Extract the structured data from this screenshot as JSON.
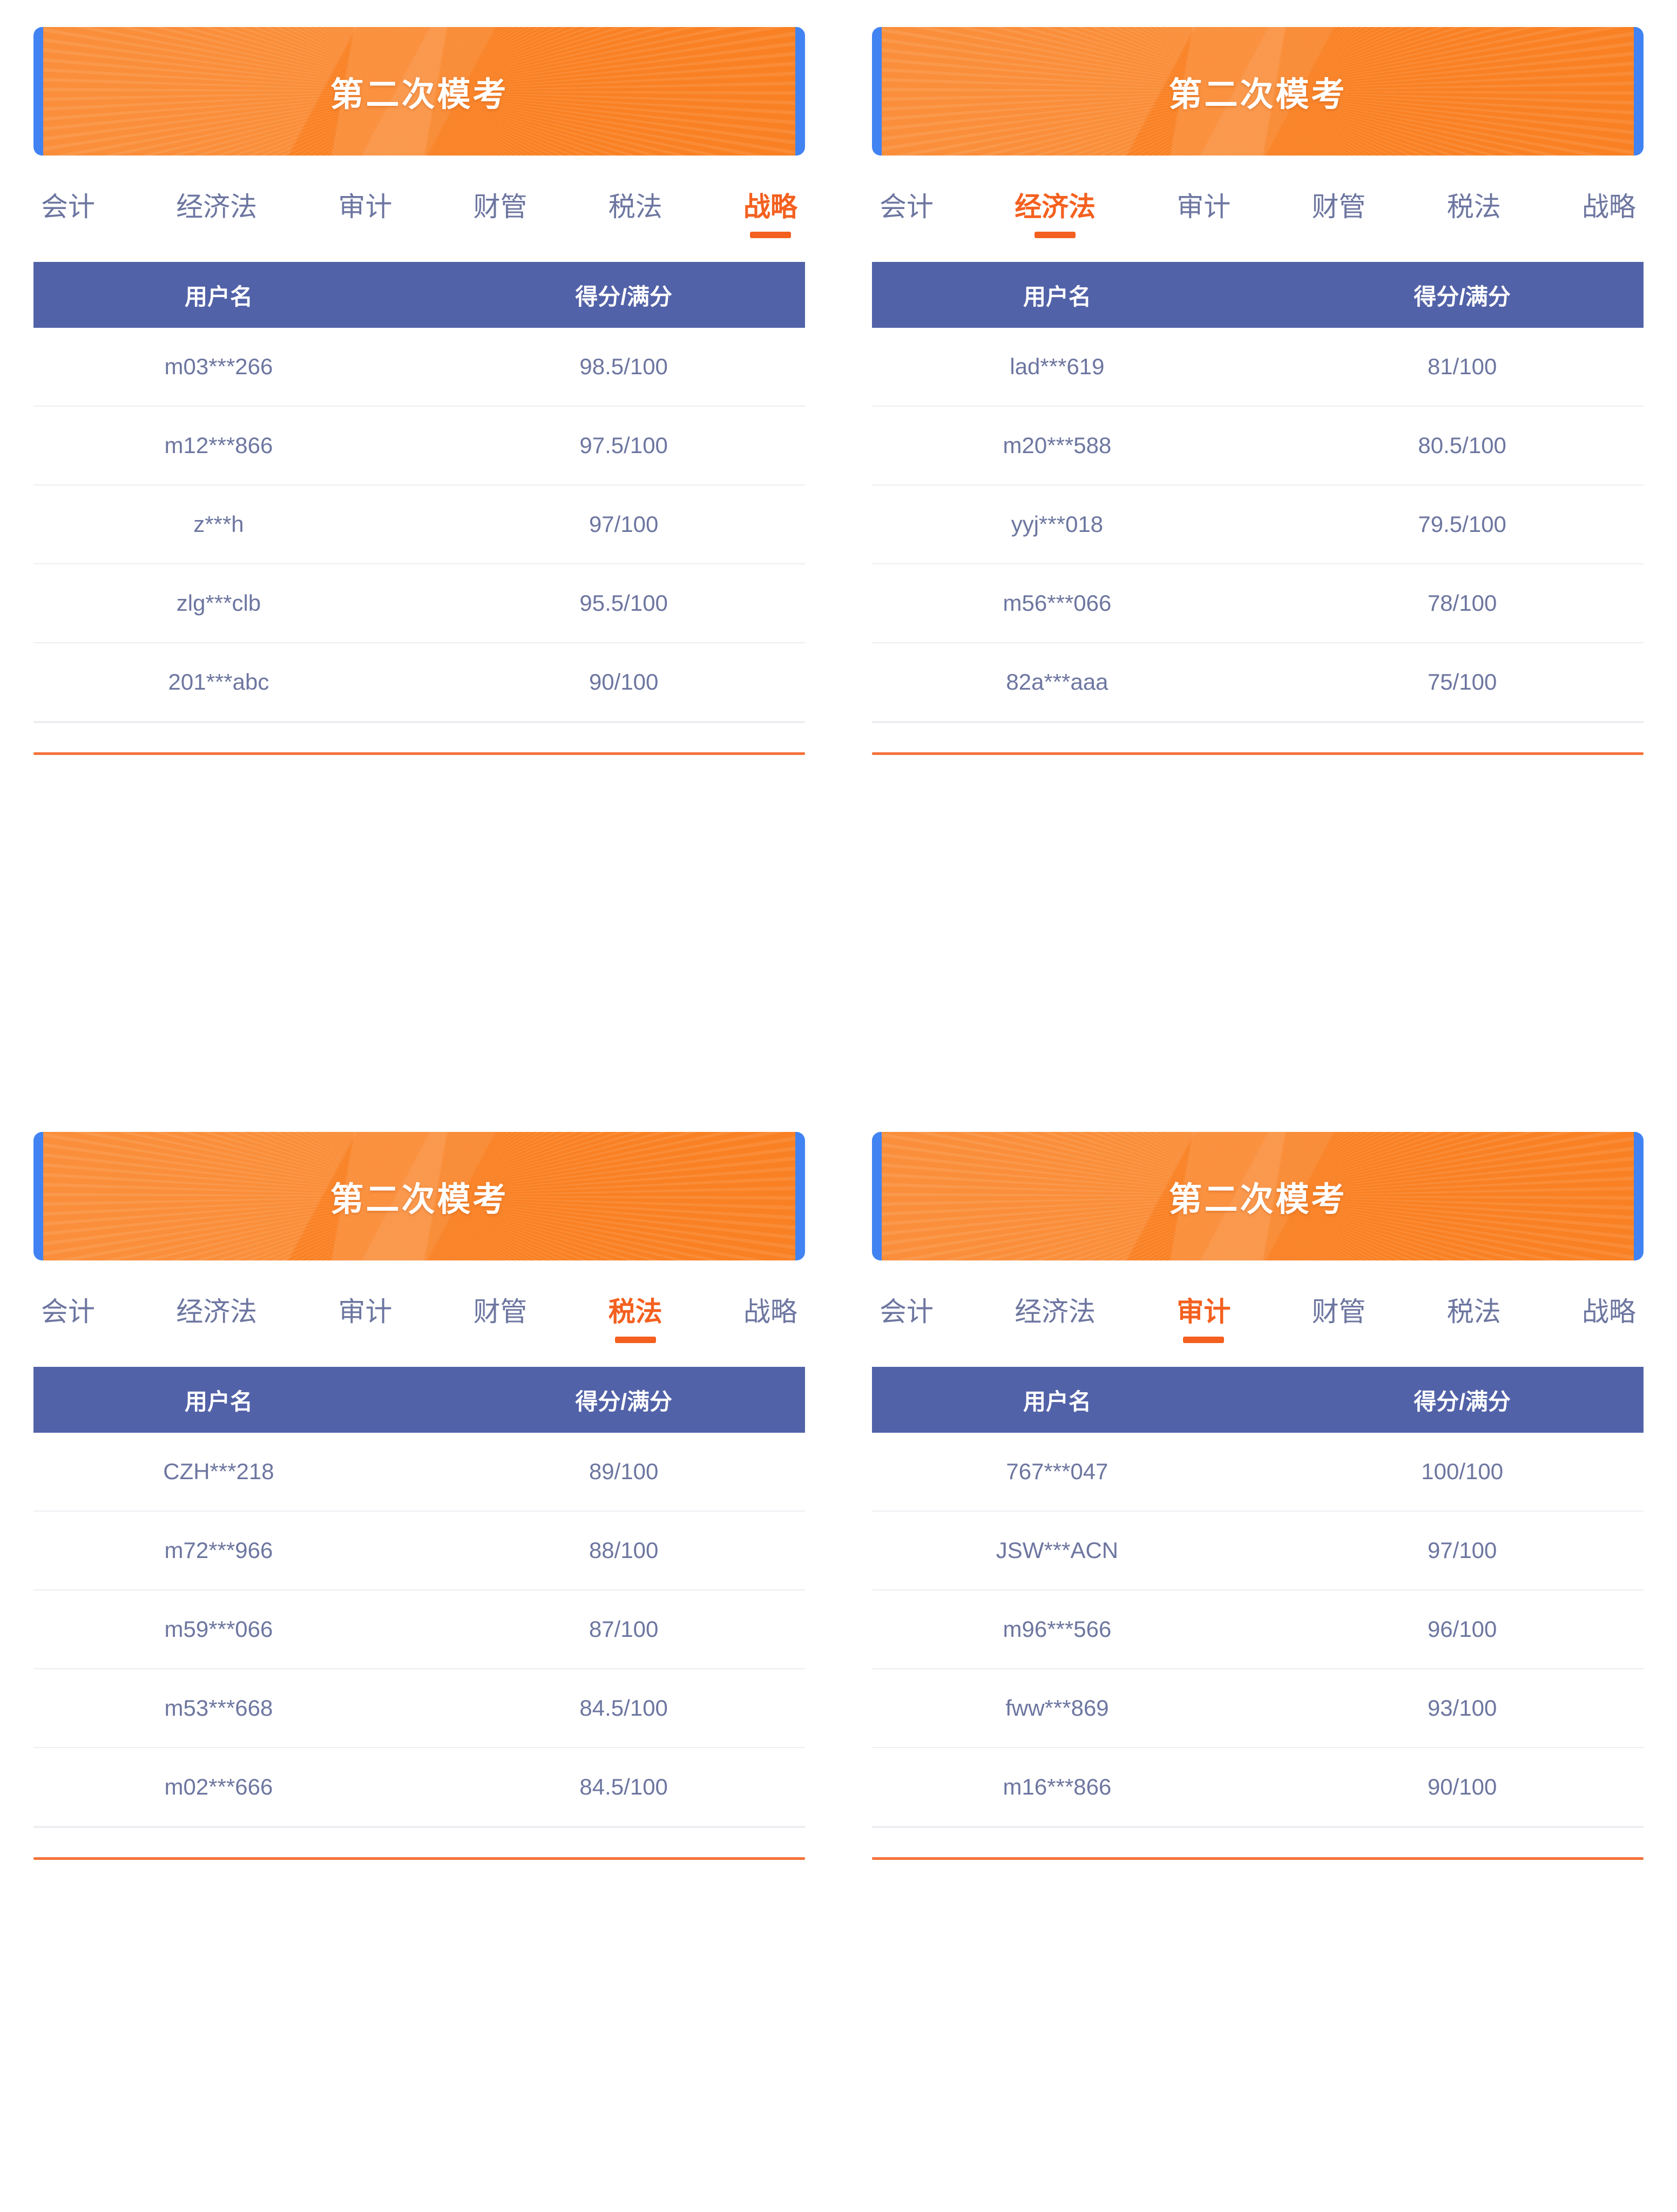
{
  "theme": {
    "banner_orange": "#f98124",
    "banner_blue": "#4183f2",
    "header_blue": "#5262a8",
    "active_orange": "#f4601f",
    "divider_orange": "#f4743c",
    "text_slate": "#6d76a0"
  },
  "table_headers": {
    "username": "用户名",
    "score": "得分/满分"
  },
  "panels": [
    {
      "banner_title": "第二次模考",
      "tabs": [
        {
          "label": "会计",
          "active": false
        },
        {
          "label": "经济法",
          "active": false
        },
        {
          "label": "审计",
          "active": false
        },
        {
          "label": "财管",
          "active": false
        },
        {
          "label": "税法",
          "active": false
        },
        {
          "label": "战略",
          "active": true
        }
      ],
      "rows": [
        {
          "username": "m03***266",
          "score": "98.5/100"
        },
        {
          "username": "m12***866",
          "score": "97.5/100"
        },
        {
          "username": "z***h",
          "score": "97/100"
        },
        {
          "username": "zlg***clb",
          "score": "95.5/100"
        },
        {
          "username": "201***abc",
          "score": "90/100"
        }
      ]
    },
    {
      "banner_title": "第二次模考",
      "tabs": [
        {
          "label": "会计",
          "active": false
        },
        {
          "label": "经济法",
          "active": true
        },
        {
          "label": "审计",
          "active": false
        },
        {
          "label": "财管",
          "active": false
        },
        {
          "label": "税法",
          "active": false
        },
        {
          "label": "战略",
          "active": false
        }
      ],
      "rows": [
        {
          "username": "lad***619",
          "score": "81/100"
        },
        {
          "username": "m20***588",
          "score": "80.5/100"
        },
        {
          "username": "yyj***018",
          "score": "79.5/100"
        },
        {
          "username": "m56***066",
          "score": "78/100"
        },
        {
          "username": "82a***aaa",
          "score": "75/100"
        }
      ]
    },
    {
      "banner_title": "第二次模考",
      "tabs": [
        {
          "label": "会计",
          "active": false
        },
        {
          "label": "经济法",
          "active": false
        },
        {
          "label": "审计",
          "active": false
        },
        {
          "label": "财管",
          "active": false
        },
        {
          "label": "税法",
          "active": true
        },
        {
          "label": "战略",
          "active": false
        }
      ],
      "rows": [
        {
          "username": "CZH***218",
          "score": "89/100"
        },
        {
          "username": "m72***966",
          "score": "88/100"
        },
        {
          "username": "m59***066",
          "score": "87/100"
        },
        {
          "username": "m53***668",
          "score": "84.5/100"
        },
        {
          "username": "m02***666",
          "score": "84.5/100"
        }
      ]
    },
    {
      "banner_title": "第二次模考",
      "tabs": [
        {
          "label": "会计",
          "active": false
        },
        {
          "label": "经济法",
          "active": false
        },
        {
          "label": "审计",
          "active": true
        },
        {
          "label": "财管",
          "active": false
        },
        {
          "label": "税法",
          "active": false
        },
        {
          "label": "战略",
          "active": false
        }
      ],
      "rows": [
        {
          "username": "767***047",
          "score": "100/100"
        },
        {
          "username": "JSW***ACN",
          "score": "97/100"
        },
        {
          "username": "m96***566",
          "score": "96/100"
        },
        {
          "username": "fww***869",
          "score": "93/100"
        },
        {
          "username": "m16***866",
          "score": "90/100"
        }
      ]
    }
  ]
}
